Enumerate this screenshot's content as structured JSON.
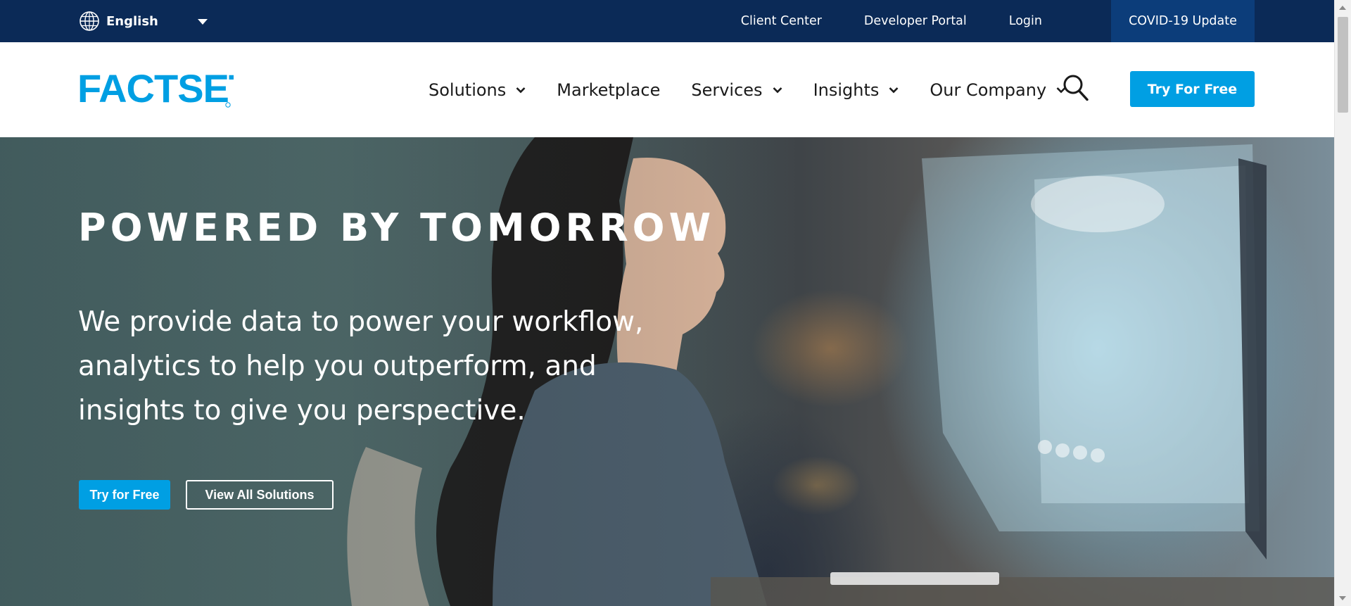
{
  "topbar": {
    "language": "English",
    "links": [
      "Client Center",
      "Developer Portal",
      "Login"
    ],
    "covid_label": "COVID-19 Update"
  },
  "nav": {
    "logo_text": "FACTSET",
    "items": [
      {
        "label": "Solutions",
        "has_dropdown": true
      },
      {
        "label": "Marketplace",
        "has_dropdown": false
      },
      {
        "label": "Services",
        "has_dropdown": true
      },
      {
        "label": "Insights",
        "has_dropdown": true
      },
      {
        "label": "Our Company",
        "has_dropdown": true
      }
    ],
    "search_icon": "search-icon",
    "cta_label": "Try For Free"
  },
  "hero": {
    "title": "POWERED BY TOMORROW",
    "subtitle": "We provide data to power your workflow, analytics to help you outperform, and insights to give you perspective.",
    "primary_button": "Try for Free",
    "secondary_button": "View All Solutions"
  },
  "colors": {
    "topbar_bg": "#0b2a57",
    "covid_bg": "#0c3d7a",
    "brand_blue": "#009fe3",
    "nav_text": "#1a1a1a"
  }
}
